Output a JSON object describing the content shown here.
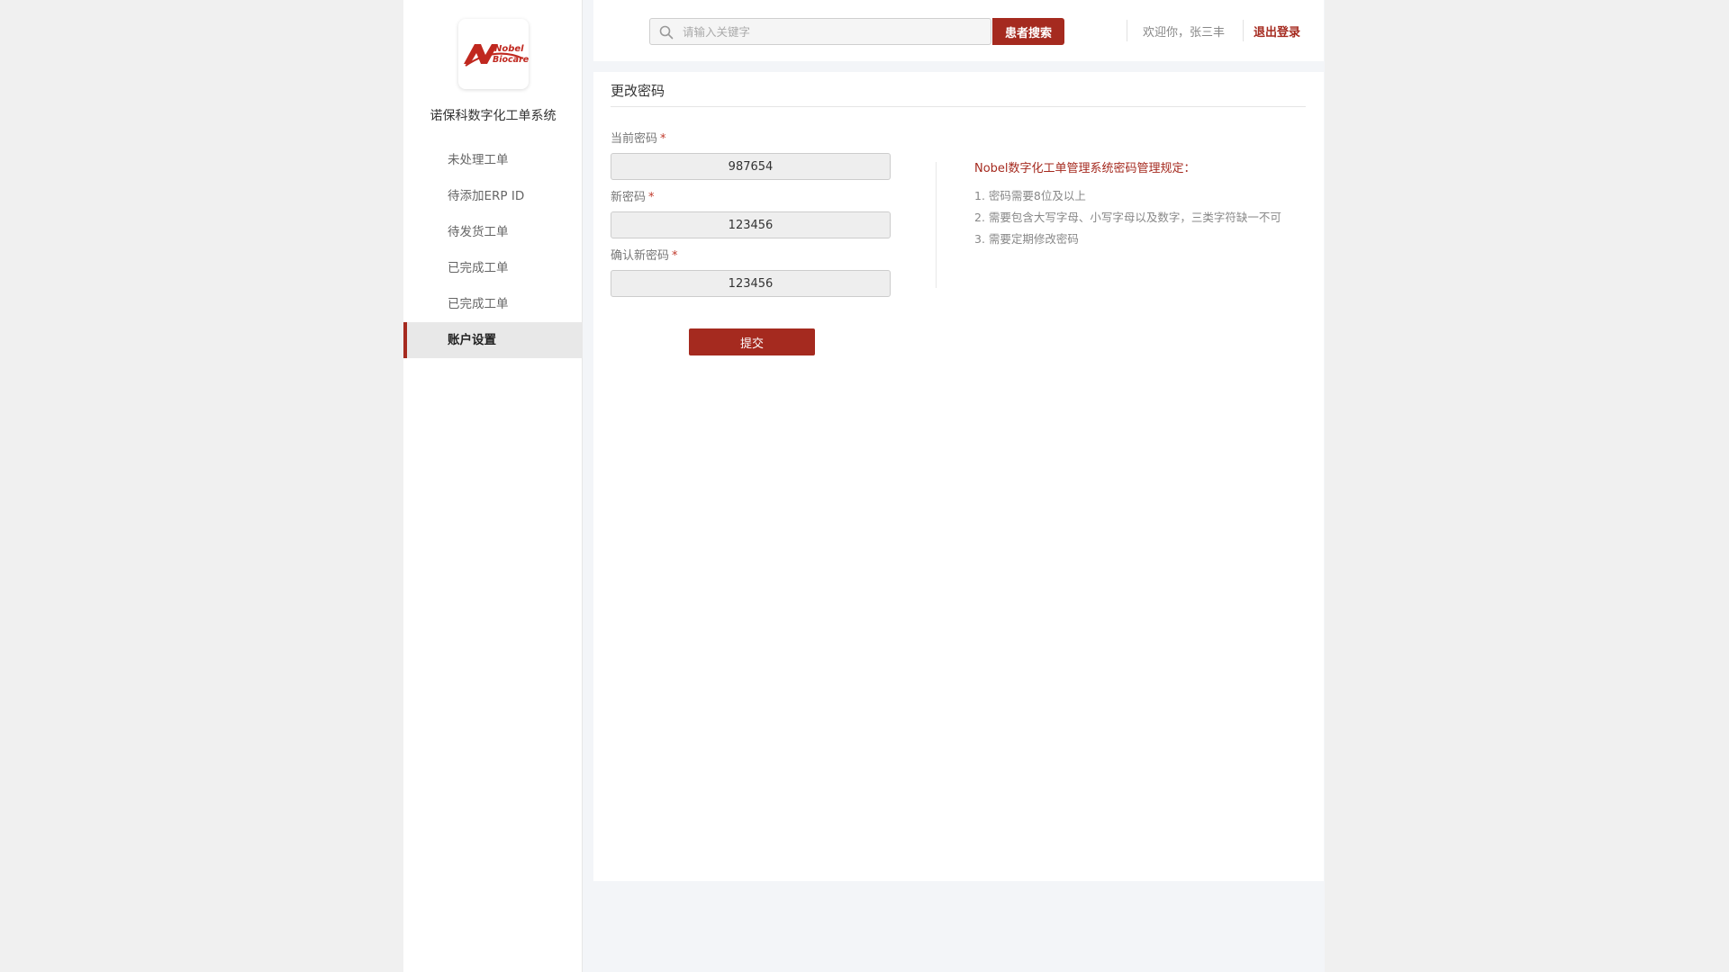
{
  "app": {
    "title": "诺保科数字化工单系统",
    "logo": {
      "line1": "Nobel",
      "line2": "Biocare"
    }
  },
  "sidebar": {
    "items": [
      {
        "label": "未处理工单",
        "active": false
      },
      {
        "label": "待添加ERP ID",
        "active": false
      },
      {
        "label": "待发货工单",
        "active": false
      },
      {
        "label": "已完成工单",
        "active": false
      },
      {
        "label": "已完成工单",
        "active": false
      },
      {
        "label": "账户设置",
        "active": true
      }
    ]
  },
  "header": {
    "search": {
      "placeholder": "请输入关键字",
      "value": "",
      "button_label": "患者搜索"
    },
    "welcome": "欢迎你，张三丰",
    "logout_label": "退出登录"
  },
  "main": {
    "title": "更改密码",
    "fields": {
      "current_password": {
        "label": "当前密码",
        "required_mark": "*",
        "value": "987654"
      },
      "new_password": {
        "label": "新密码",
        "required_mark": "*",
        "value": "123456"
      },
      "confirm_password": {
        "label": "确认新密码",
        "required_mark": "*",
        "value": "123456"
      }
    },
    "submit_label": "提交",
    "rules": {
      "title": "Nobel数字化工单管理系统密码管理规定：",
      "items": [
        "1. 密码需要8位及以上",
        "2. 需要包含大写字母、小写字母以及数字，三类字符缺一不可",
        "3. 需要定期修改密码"
      ]
    }
  },
  "colors": {
    "accent": "#a52a1f",
    "background": "#f3f5f8",
    "sidebar_active_bg": "#e8e8e8"
  },
  "icons": {
    "search": "search-icon",
    "logo": "nobel-biocare-logo"
  }
}
